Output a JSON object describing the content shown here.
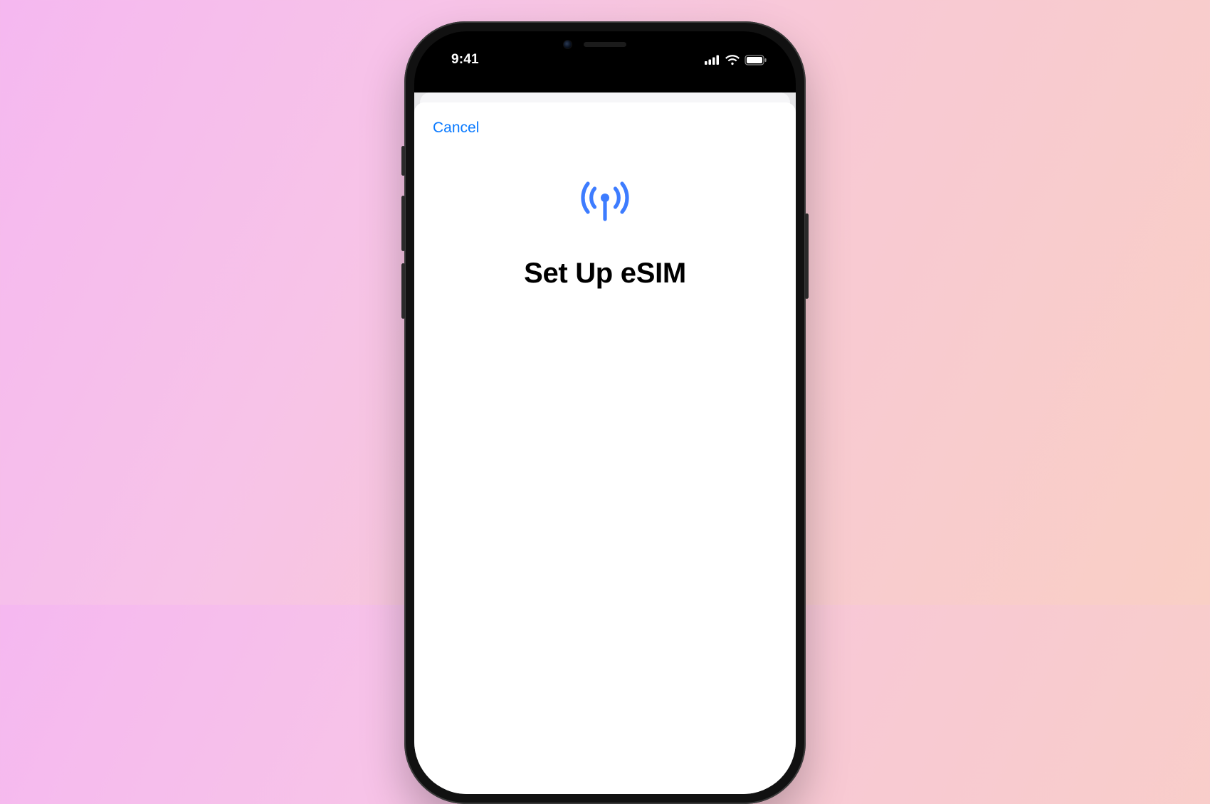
{
  "status_bar": {
    "time": "9:41"
  },
  "sheet": {
    "cancel_label": "Cancel",
    "title": "Set Up eSIM",
    "icon_name": "cellular-antenna-icon",
    "colors": {
      "accent_blue": "#0a7aff",
      "icon_blue": "#3d7cff"
    }
  }
}
